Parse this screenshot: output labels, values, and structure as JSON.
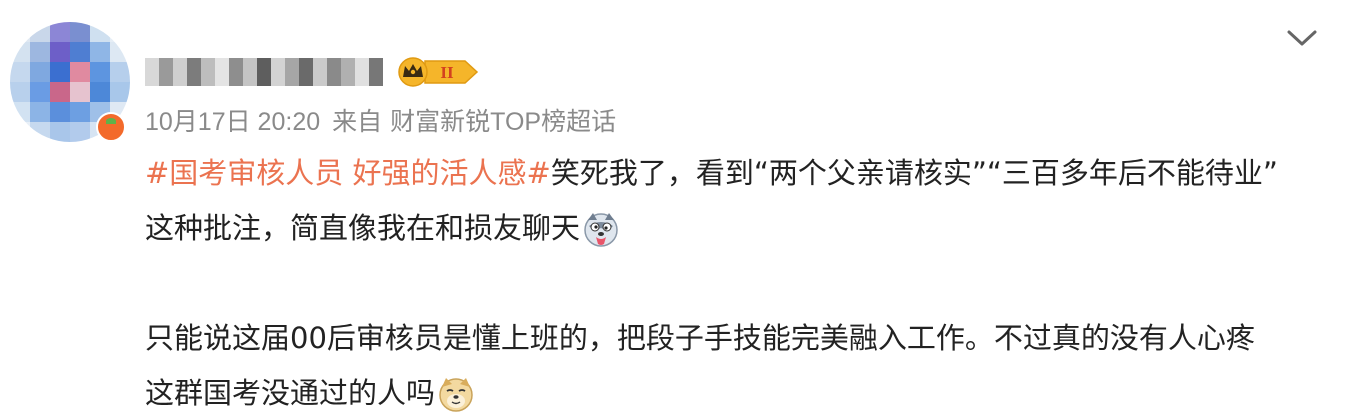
{
  "post": {
    "meta": {
      "time": "10月17日 20:20",
      "from_label": "来自",
      "source": "财富新锐TOP榜超话"
    },
    "badge": {
      "level": "II",
      "colors": {
        "gold": "#f5b52a",
        "dark": "#3a2a12"
      }
    },
    "icons": {
      "expand": "chevron-down-icon",
      "emoji_1": "dog-tongue-emoji",
      "emoji_2": "doge-emoji"
    },
    "content": {
      "hashtag": "#国考审核人员 好强的活人感#",
      "line1_text": "笑死我了，看到“两个父亲请核实”“三百多年后不能待业”",
      "line2_text": "这种批注，简直像我在和损友聊天",
      "line3_text": "只能说这届00后审核员是懂上班的，把段子手技能完美融入工作。不过真的没有人心疼",
      "line4_text": "这群国考没通过的人吗"
    },
    "colors": {
      "hashtag": "#eb7350",
      "meta": "#8a8a8a",
      "text": "#222222"
    }
  }
}
